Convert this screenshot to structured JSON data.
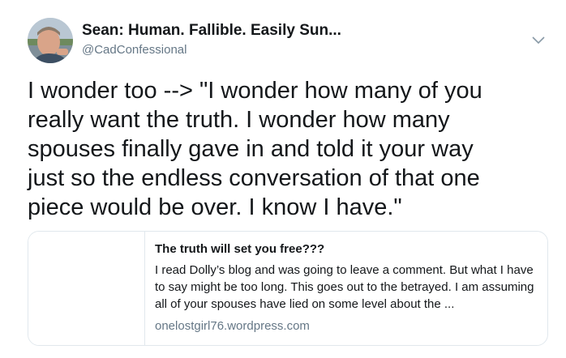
{
  "tweet": {
    "display_name": "Sean: Human. Fallible. Easily Sun...",
    "handle": "@CadConfessional",
    "avatar_icon": "user-avatar",
    "menu_icon": "chevron-down-icon",
    "text": "I wonder too --> \"I wonder how many of you\nreally want the truth. I wonder how many\nspouses finally gave in and told it your way\njust so the endless conversation of that one\npiece would be over. I know I have.\""
  },
  "card": {
    "title": "The truth will set you free???",
    "description": "I read Dolly’s blog and was going to leave a comment. But what I have to say might be too long. This goes out to the betrayed. I am assuming all of your spouses have lied on some level about the ...",
    "domain": "onelostgirl76.wordpress.com"
  },
  "colors": {
    "text": "#14171a",
    "secondary": "#657786",
    "border": "#e1e8ed"
  }
}
